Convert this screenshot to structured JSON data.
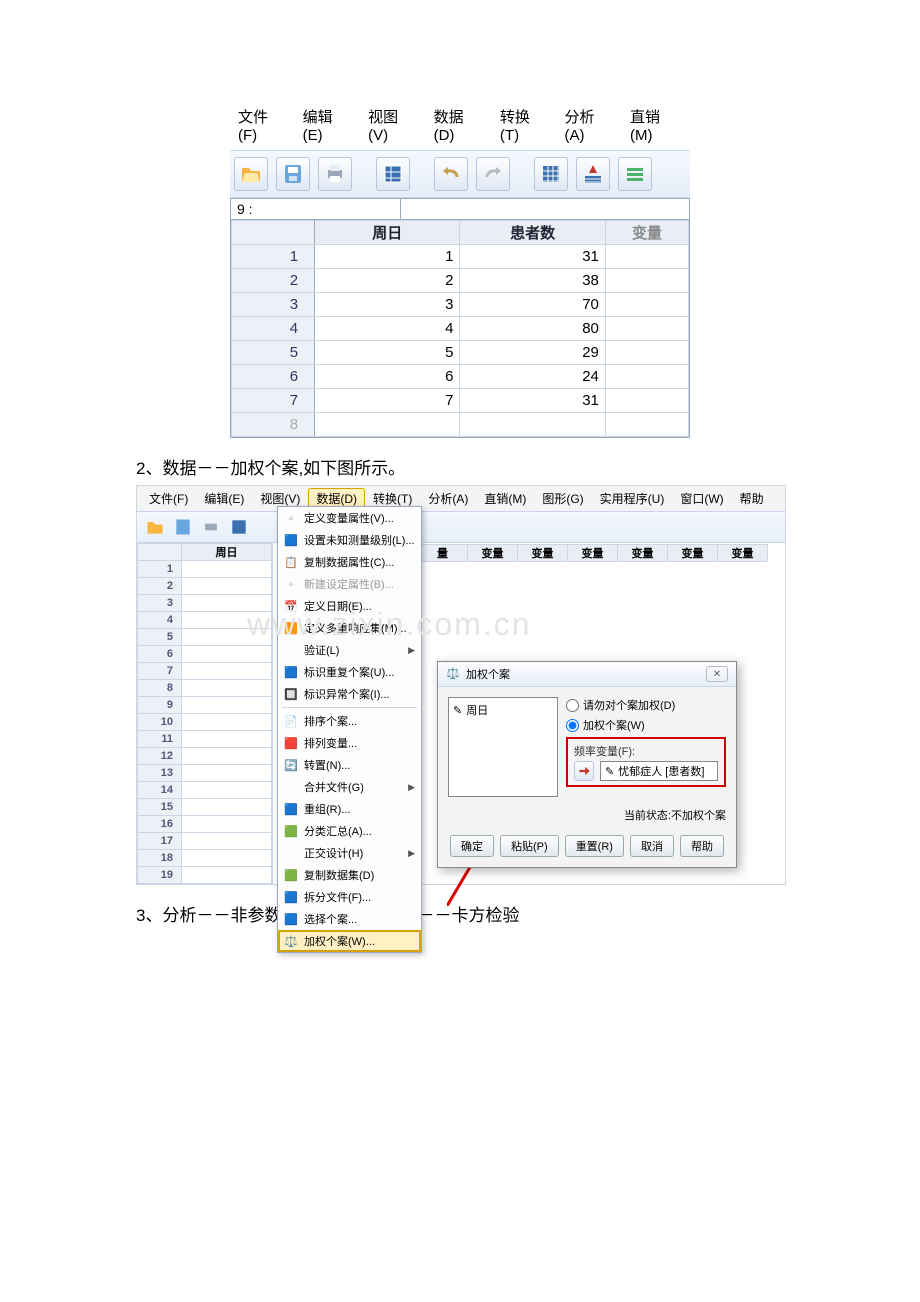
{
  "shot1": {
    "menu": {
      "file": "文件(F)",
      "edit": "编辑(E)",
      "view": "视图(V)",
      "data": "数据(D)",
      "transform": "转换(T)",
      "analyze": "分析(A)",
      "dmarket": "直销(M)"
    },
    "cell_label": "9 :",
    "cols": {
      "c1": "周日",
      "c2": "患者数",
      "c3": "变量"
    },
    "rows": [
      {
        "n": "1",
        "a": "1",
        "b": "31"
      },
      {
        "n": "2",
        "a": "2",
        "b": "38"
      },
      {
        "n": "3",
        "a": "3",
        "b": "70"
      },
      {
        "n": "4",
        "a": "4",
        "b": "80"
      },
      {
        "n": "5",
        "a": "5",
        "b": "29"
      },
      {
        "n": "6",
        "a": "6",
        "b": "24"
      },
      {
        "n": "7",
        "a": "7",
        "b": "31"
      },
      {
        "n": "8",
        "a": "",
        "b": ""
      }
    ]
  },
  "step2": "2、数据－－加权个案,如下图所示。",
  "shot2": {
    "menu": {
      "file": "文件(F)",
      "edit": "编辑(E)",
      "view": "视图(V)",
      "data": "数据(D)",
      "transform": "转换(T)",
      "analyze": "分析(A)",
      "dmarket": "直销(M)",
      "graph": "图形(G)",
      "util": "实用程序(U)",
      "window": "窗口(W)",
      "help": "帮助"
    },
    "leftcol": "周日",
    "rownums": [
      "1",
      "2",
      "3",
      "4",
      "5",
      "6",
      "7",
      "8",
      "9",
      "10",
      "11",
      "12",
      "13",
      "14",
      "15",
      "16",
      "17",
      "18",
      "19"
    ],
    "varcols": [
      "量",
      "变量",
      "变量",
      "变量",
      "变量",
      "变量",
      "变量"
    ],
    "drop": {
      "defvar": "定义变量属性(V)...",
      "setunk": "设置未知测量级别(L)...",
      "copyprop": "复制数据属性(C)...",
      "newcust": "新建设定属性(B)...",
      "defdate": "定义日期(E)...",
      "defmrs": "定义多重响应集(M)...",
      "valid": "验证(L)",
      "iddup": "标识重复个案(U)...",
      "idunu": "标识异常个案(I)...",
      "sortc": "排序个案...",
      "sortv": "排列变量...",
      "trans": "转置(N)...",
      "merge": "合并文件(G)",
      "restr": "重组(R)...",
      "aggr": "分类汇总(A)...",
      "orth": "正交设计(H)",
      "copyds": "复制数据集(D)",
      "split": "拆分文件(F)...",
      "selc": "选择个案...",
      "weight": "加权个案(W)..."
    },
    "dialog": {
      "title": "加权个案",
      "listfield": "周日",
      "opt_none": "请勿对个案加权(D)",
      "opt_weight": "加权个案(W)",
      "freq_label": "频率变量(F):",
      "freq_field": "忧郁症人 [患者数]",
      "status": "当前状态:不加权个案",
      "btn_ok": "确定",
      "btn_paste": "粘贴(P)",
      "btn_reset": "重置(R)",
      "btn_cancel": "取消",
      "btn_help": "帮助"
    }
  },
  "step3": "3、分析－－非参数检验－－旧对话框－－卡方检验"
}
